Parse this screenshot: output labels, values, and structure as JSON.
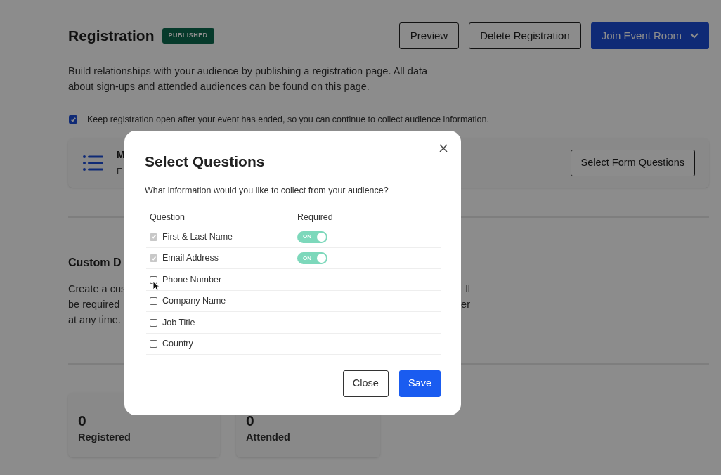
{
  "page": {
    "title": "Registration",
    "badge": "PUBLISHED",
    "buttons": [
      {
        "label": "Preview",
        "kind": "outline"
      },
      {
        "label": "Delete Registration",
        "kind": "outline"
      },
      {
        "label": "Join Event Room",
        "kind": "primary-dropdown"
      }
    ],
    "intro": "Build relationships with your audience by publishing a registration page. All data about sign-ups and attended audiences can be found on this page.",
    "keep_open": {
      "label": "Keep registration open after your event has ended, so you can continue to collect audience information.",
      "checked": true
    },
    "form_card": {
      "title": "M",
      "subtitle": "E",
      "button": "Select Form Questions"
    },
    "custom": {
      "heading": "Custom D",
      "lines": [
        [
          "Create a cus",
          "ll"
        ],
        [
          "be required",
          "er"
        ],
        [
          "at any time."
        ]
      ]
    },
    "stats": [
      {
        "value": "0",
        "label": "Registered"
      },
      {
        "value": "0",
        "label": "Attended"
      }
    ]
  },
  "dialog": {
    "title": "Select Questions",
    "subtitle": "What information would you like to collect from your audience?",
    "columns": [
      "Question",
      "Required"
    ],
    "rows": [
      {
        "label": "First & Last Name",
        "checked": true,
        "disabled": true,
        "required": true,
        "toggle_text": "ON"
      },
      {
        "label": "Email Address",
        "checked": true,
        "disabled": true,
        "required": true,
        "toggle_text": "ON"
      },
      {
        "label": "Phone Number",
        "checked": false,
        "disabled": false,
        "required": false
      },
      {
        "label": "Company Name",
        "checked": false,
        "disabled": false,
        "required": false
      },
      {
        "label": "Job Title",
        "checked": false,
        "disabled": false,
        "required": false
      },
      {
        "label": "Country",
        "checked": false,
        "disabled": false,
        "required": false
      }
    ],
    "buttons": [
      {
        "label": "Close",
        "kind": "outline"
      },
      {
        "label": "Save",
        "kind": "primary"
      }
    ]
  }
}
